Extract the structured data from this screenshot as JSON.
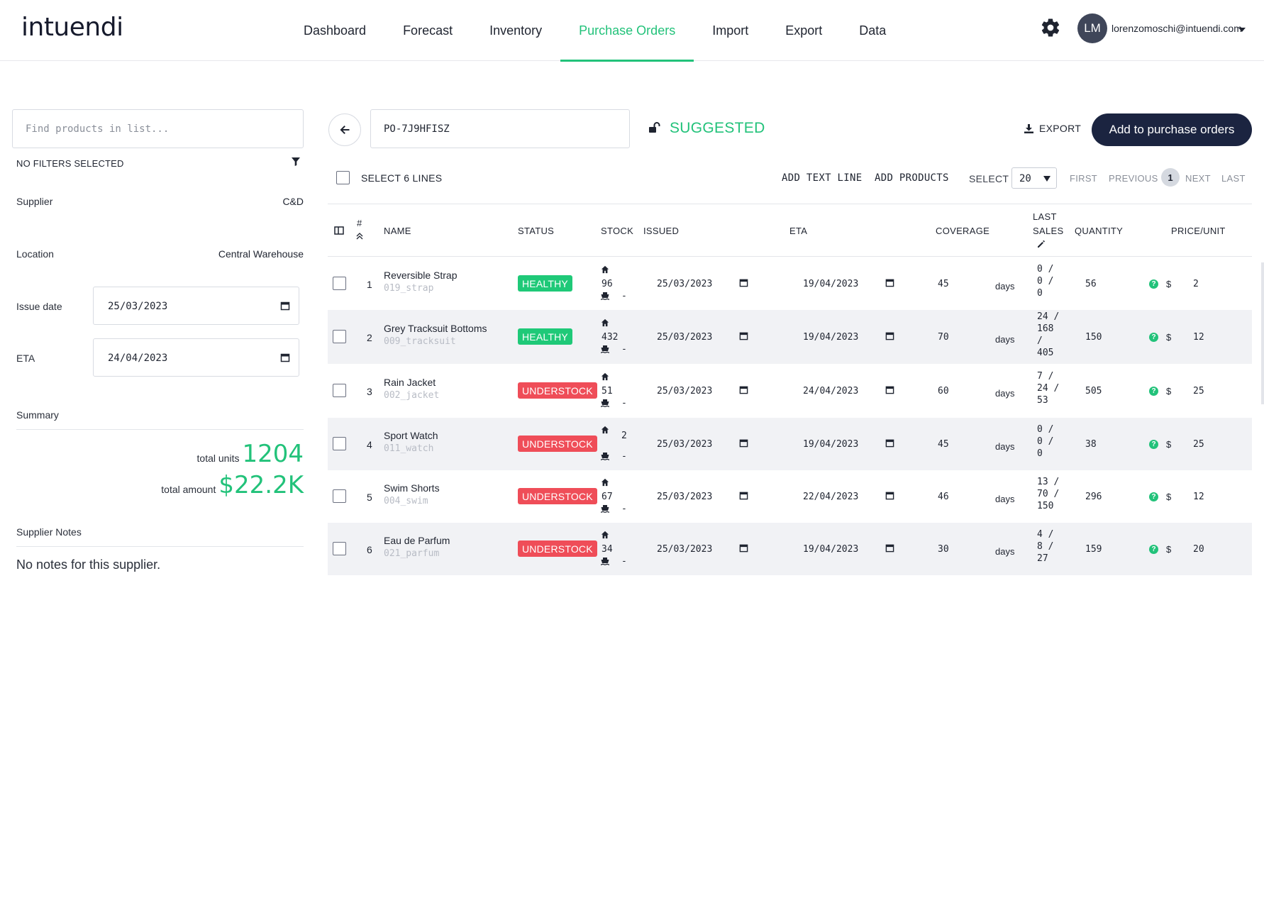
{
  "app": {
    "logo": "intuendi",
    "nav": [
      {
        "label": "Dashboard"
      },
      {
        "label": "Forecast"
      },
      {
        "label": "Inventory"
      },
      {
        "label": "Purchase Orders",
        "active": true
      },
      {
        "label": "Import"
      },
      {
        "label": "Export"
      },
      {
        "label": "Data"
      }
    ],
    "user": {
      "initials": "LM",
      "email": "lorenzomoschi@intuendi.com"
    }
  },
  "sidebar": {
    "search_placeholder": "Find products in list...",
    "filters_label": "NO FILTERS SELECTED",
    "supplier": {
      "label": "Supplier",
      "value": "C&D"
    },
    "location": {
      "label": "Location",
      "value": "Central Warehouse"
    },
    "issue_date": {
      "label": "Issue date",
      "value": "25/03/2023"
    },
    "eta": {
      "label": "ETA",
      "value": "24/04/2023"
    },
    "summary": {
      "title": "Summary",
      "total_units_label": "total units",
      "total_units": "1204",
      "total_amount_label": "total amount",
      "total_amount": "$22.2K"
    },
    "notes": {
      "title": "Supplier Notes",
      "text": "No notes for this supplier."
    }
  },
  "order": {
    "po_number": "PO-7J9HFISZ",
    "status": "SUGGESTED",
    "export_label": "EXPORT",
    "add_button": "Add to purchase orders"
  },
  "toolbar": {
    "select_lines": "SELECT 6 LINES",
    "add_text_line": "ADD TEXT LINE",
    "add_products": "ADD PRODUCTS",
    "select_label": "SELECT",
    "page_size": "20",
    "first": "FIRST",
    "previous": "PREVIOUS",
    "current_page": "1",
    "next": "NEXT",
    "last": "LAST"
  },
  "table": {
    "headers": {
      "num": "#",
      "name": "NAME",
      "status": "STATUS",
      "stock": "STOCK",
      "issued": "ISSUED",
      "eta": "ETA",
      "coverage": "COVERAGE",
      "last_sales_1": "LAST",
      "last_sales_2": "SALES",
      "quantity": "QUANTITY",
      "price": "PRICE/UNIT"
    },
    "days_label": "days",
    "currency": "$",
    "dash": "-",
    "slash": "/",
    "rows": [
      {
        "num": "1",
        "name": "Reversible Strap",
        "code": "019_strap",
        "status": "HEALTHY",
        "stock": "96",
        "issued": "25/03/2023",
        "eta": "19/04/2023",
        "coverage": "45",
        "sales": [
          "0 /",
          "0 /",
          "0"
        ],
        "quantity": "56",
        "price": "2"
      },
      {
        "num": "2",
        "name": "Grey Tracksuit Bottoms",
        "code": "009_tracksuit",
        "status": "HEALTHY",
        "stock": "432",
        "issued": "25/03/2023",
        "eta": "19/04/2023",
        "coverage": "70",
        "sales": [
          "24 /",
          "168",
          "/",
          "405"
        ],
        "quantity": "150",
        "price": "12"
      },
      {
        "num": "3",
        "name": "Rain Jacket",
        "code": "002_jacket",
        "status": "UNDERSTOCK",
        "stock": "51",
        "issued": "25/03/2023",
        "eta": "24/04/2023",
        "coverage": "60",
        "sales": [
          "7 /",
          "24 /",
          "53"
        ],
        "quantity": "505",
        "price": "25"
      },
      {
        "num": "4",
        "name": "Sport Watch",
        "code": "011_watch",
        "status": "UNDERSTOCK",
        "stock": "2",
        "issued": "25/03/2023",
        "eta": "19/04/2023",
        "coverage": "45",
        "sales": [
          "0 /",
          "0 /",
          "0"
        ],
        "quantity": "38",
        "price": "25"
      },
      {
        "num": "5",
        "name": "Swim Shorts",
        "code": "004_swim",
        "status": "UNDERSTOCK",
        "stock": "67",
        "issued": "25/03/2023",
        "eta": "22/04/2023",
        "coverage": "46",
        "sales": [
          "13 /",
          "70 /",
          "150"
        ],
        "quantity": "296",
        "price": "12"
      },
      {
        "num": "6",
        "name": "Eau de Parfum",
        "code": "021_parfum",
        "status": "UNDERSTOCK",
        "stock": "34",
        "issued": "25/03/2023",
        "eta": "19/04/2023",
        "coverage": "30",
        "sales": [
          "4 /",
          "8 /",
          "27"
        ],
        "quantity": "159",
        "price": "20"
      }
    ]
  },
  "colors": {
    "accent": "#22c27a",
    "danger": "#ef4d58",
    "navy": "#1b2440"
  }
}
